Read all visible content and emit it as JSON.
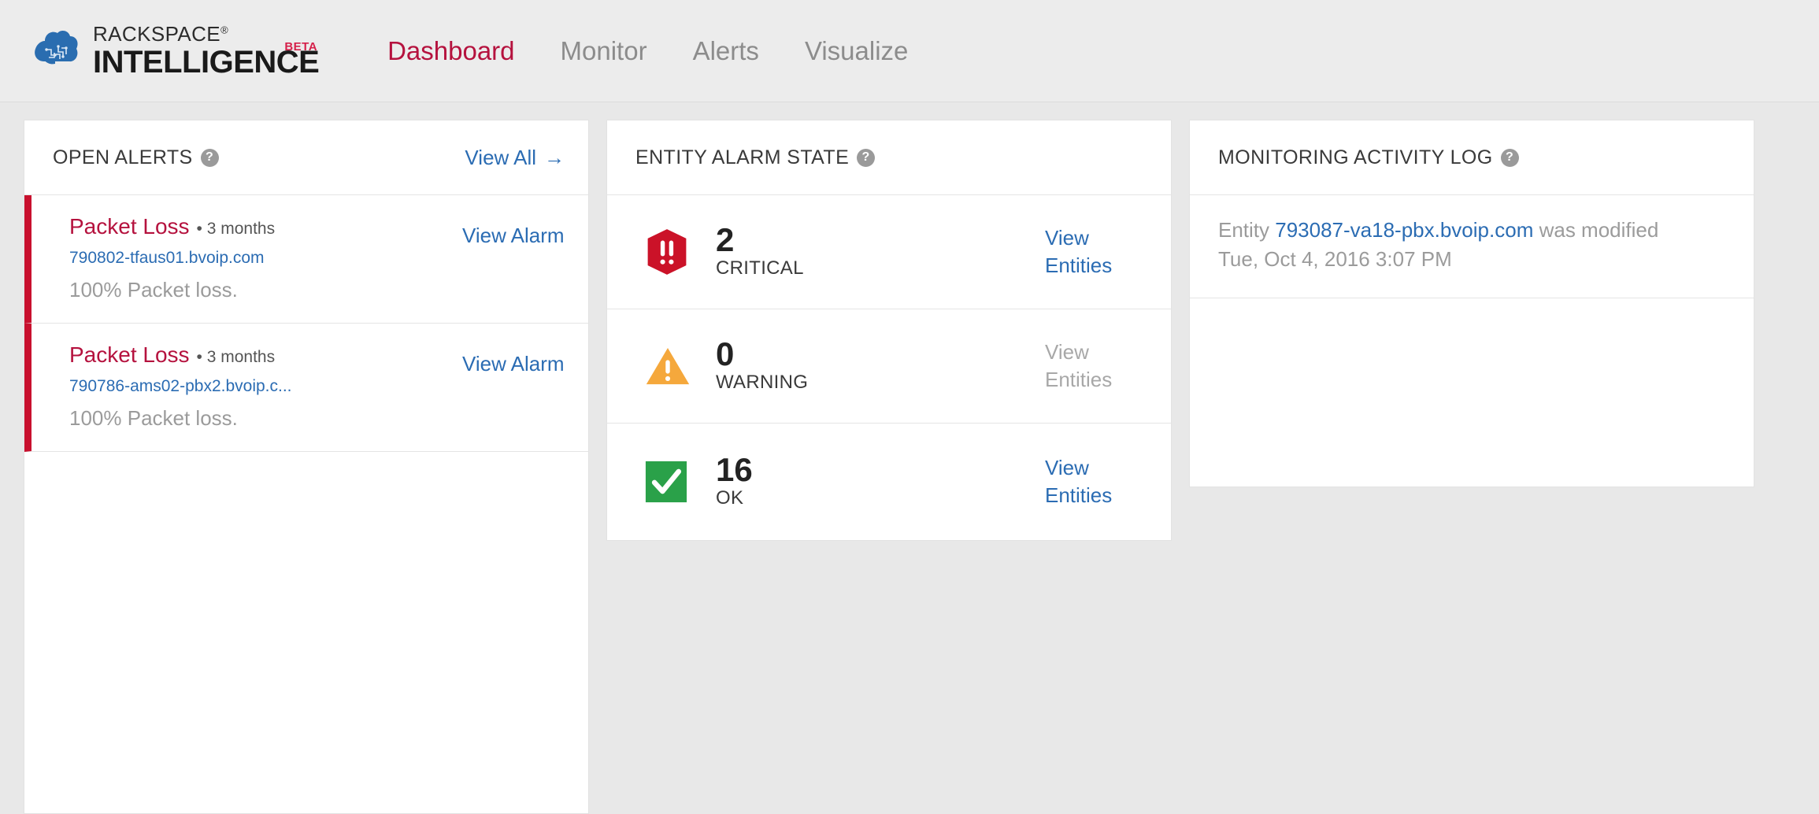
{
  "brand": {
    "rackspace": "RACKSPACE",
    "registered": "®",
    "intelligence": "INTELLIGENCE",
    "beta": "BETA",
    "logo_icon": "rackspace-cloud-logo"
  },
  "nav": {
    "items": [
      {
        "label": "Dashboard",
        "active": true
      },
      {
        "label": "Monitor",
        "active": false
      },
      {
        "label": "Alerts",
        "active": false
      },
      {
        "label": "Visualize",
        "active": false
      }
    ]
  },
  "colors": {
    "brand_red": "#b5123e",
    "critical_red": "#c8102e",
    "warning_orange": "#f5a83c",
    "ok_green": "#2aa149",
    "link_blue": "#2b6cb3",
    "page_bg": "#e8e8e8",
    "panel_bg": "#ffffff"
  },
  "open_alerts": {
    "title": "OPEN ALERTS",
    "help_icon": "help-circle-icon",
    "view_all_label": "View All",
    "view_all_arrow": "→",
    "rows": [
      {
        "title": "Packet Loss",
        "age": "3 months",
        "entity": "790802-tfaus01.bvoip.com",
        "description": "100% Packet loss.",
        "action": "View Alarm",
        "severity_color": "#c8102e"
      },
      {
        "title": "Packet Loss",
        "age": "3 months",
        "entity": "790786-ams02-pbx2.bvoip.c...",
        "description": "100% Packet loss.",
        "action": "View Alarm",
        "severity_color": "#c8102e"
      }
    ]
  },
  "entity_alarm_state": {
    "title": "ENTITY ALARM STATE",
    "help_icon": "help-circle-icon",
    "rows": [
      {
        "icon": "critical-hexagon-icon",
        "count": "2",
        "label": "CRITICAL",
        "action": "View Entities",
        "action_enabled": true
      },
      {
        "icon": "warning-triangle-icon",
        "count": "0",
        "label": "WARNING",
        "action": "View Entities",
        "action_enabled": false
      },
      {
        "icon": "ok-check-square-icon",
        "count": "16",
        "label": "OK",
        "action": "View Entities",
        "action_enabled": true
      }
    ]
  },
  "monitoring_activity_log": {
    "title": "MONITORING ACTIVITY LOG",
    "help_icon": "help-circle-icon",
    "rows": [
      {
        "prefix": "Entity ",
        "entity": "793087-va18-pbx.bvoip.com",
        "suffix": " was modified",
        "timestamp": "Tue, Oct 4, 2016 3:07 PM"
      }
    ]
  }
}
